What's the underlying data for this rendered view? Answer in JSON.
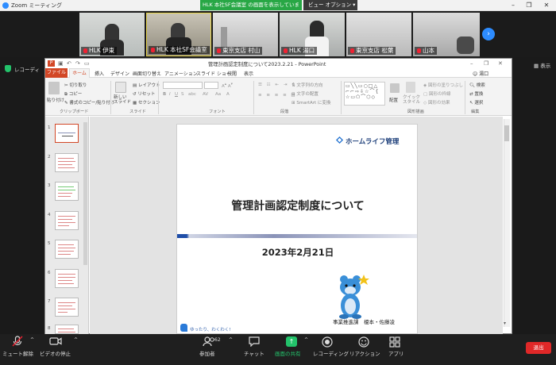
{
  "zoom": {
    "app_title": "Zoom ミーティング",
    "share_banner": "HLK 本社SF会議室 の画面を表示しています",
    "view_options": "ビュー オプション",
    "record_label": "レコーディ",
    "show_label": "表示",
    "participants": [
      {
        "name": "HLK 伊東"
      },
      {
        "name": "HLK 本社SF会議室"
      },
      {
        "name": "東京支店 村山"
      },
      {
        "name": "HLK 湯口"
      },
      {
        "name": "東京支店 松葉"
      },
      {
        "name": "山本"
      }
    ],
    "toolbar": {
      "mute": "ミュート解除",
      "video": "ビデオの停止",
      "participants": "参加者",
      "participant_count": "62",
      "chat": "チャット",
      "share": "画面の共有",
      "record": "レコーディング",
      "reactions": "リアクション",
      "apps": "アプリ",
      "end": "退出"
    }
  },
  "powerpoint": {
    "window_title": "管理計画認定制度について2023.2.21 - PowerPoint",
    "user": "湯口",
    "tabs": [
      "ファイル",
      "ホーム",
      "挿入",
      "デザイン",
      "画面切り替え",
      "アニメーション",
      "スライド ショー",
      "校閲",
      "表示"
    ],
    "ribbon": {
      "paste": "貼り付け",
      "cut": "切り取り",
      "copy": "コピー",
      "format_copy": "書式のコピー/貼り付け",
      "new_slide": "新しい スライド",
      "layout": "レイアウト",
      "reset": "リセット",
      "section": "セクション",
      "text_direction": "文字列の方向",
      "text_align": "文字の配置",
      "smartart": "SmartArt に変換",
      "arrange": "配置",
      "quick_style": "クイック スタイル",
      "shape_fill": "図形の塗りつぶし",
      "shape_outline": "図形の枠線",
      "shape_effect": "図形の効果",
      "find": "検索",
      "replace": "置換",
      "select": "選択",
      "groups": {
        "clipboard": "クリップボード",
        "slides": "スライド",
        "font": "フォント",
        "paragraph": "段落",
        "drawing": "図形描画",
        "editing": "編集"
      }
    },
    "thumb_numbers": [
      "1",
      "2",
      "3",
      "4",
      "5",
      "6",
      "7",
      "8"
    ],
    "slide": {
      "logo_text": "ホームライフ管理",
      "title": "管理計画認定制度について",
      "date": "2023年2月21日",
      "dept": "事業推進課　榎本・佐藤凌",
      "motto": "ゆったり、わくわく!"
    }
  },
  "colors": {
    "ppt_accent": "#d24726",
    "zoom_green": "#28a745",
    "zoom_blue": "#2d8cff",
    "end_red": "#e02828"
  }
}
